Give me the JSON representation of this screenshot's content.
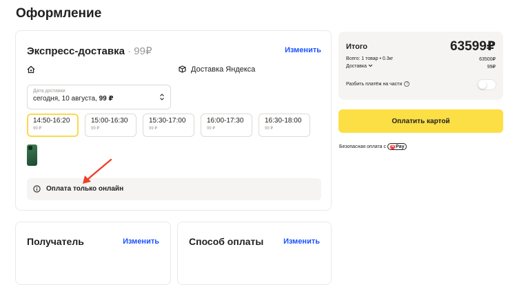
{
  "page": {
    "title": "Оформление"
  },
  "delivery": {
    "title": "Экспресс-доставка",
    "price": "· 99₽",
    "change_label": "Изменить",
    "provider": "Доставка Яндекса",
    "date": {
      "caption": "Дата доставки",
      "value": "сегодня, 10 августа,",
      "price": "99 ₽"
    },
    "slots": [
      {
        "time": "14:50-16:20",
        "price": "99 ₽",
        "active": true
      },
      {
        "time": "15:00-16:30",
        "price": "99 ₽"
      },
      {
        "time": "15:30-17:00",
        "price": "99 ₽"
      },
      {
        "time": "16:00-17:30",
        "price": "99 ₽"
      },
      {
        "time": "16:30-18:00",
        "price": "99 ₽"
      }
    ],
    "notice": "Оплата только онлайн",
    "icons": [
      "home-icon",
      "yandex-delivery-icon",
      "info-icon",
      "phone-thumbnail"
    ]
  },
  "recipient": {
    "title": "Получатель",
    "change_label": "Изменить"
  },
  "payment_method": {
    "title": "Способ оплаты",
    "change_label": "Изменить"
  },
  "summary": {
    "title": "Итого",
    "amount": "63599₽",
    "items_label": "Всего: 1 товар • 0.3кг",
    "items_value": "63500₽",
    "delivery_label": "Доставка",
    "delivery_value": "99₽",
    "split_label": "Разбить платёж на части",
    "split_enabled": false
  },
  "pay_button_label": "Оплатить картой",
  "secure_label": "Безопасная оплата с",
  "ypay_label": "Pay",
  "colors": {
    "accent_yellow": "#fcdf45",
    "link_blue": "#1a53ff",
    "annotation_red": "#ee3f2a"
  }
}
